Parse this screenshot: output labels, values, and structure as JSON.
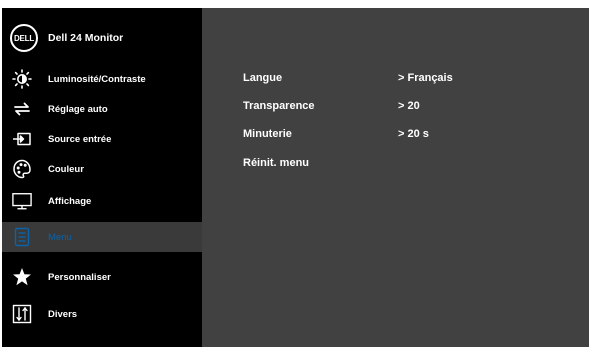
{
  "header": {
    "title": "Dell 24 Monitor",
    "logo_text": "DELL"
  },
  "sidebar": {
    "items": [
      {
        "label": "Luminosité/Contraste",
        "icon": "brightness-icon"
      },
      {
        "label": "Réglage auto",
        "icon": "auto-adjust-icon"
      },
      {
        "label": "Source entrée",
        "icon": "input-source-icon"
      },
      {
        "label": "Couleur",
        "icon": "color-palette-icon"
      },
      {
        "label": "Affichage",
        "icon": "display-icon"
      },
      {
        "label": "Menu",
        "icon": "menu-icon",
        "selected": true
      },
      {
        "label": "Personnaliser",
        "icon": "star-icon"
      },
      {
        "label": "Divers",
        "icon": "others-icon"
      }
    ]
  },
  "settings": [
    {
      "name": "Langue",
      "value": "> Français"
    },
    {
      "name": "Transparence",
      "value": "> 20"
    },
    {
      "name": "Minuterie",
      "value": "> 20 s"
    },
    {
      "name": "Réinit. menu",
      "value": ""
    }
  ],
  "colors": {
    "accent": "#0b63a8",
    "panel": "#414141",
    "sidebar": "#000000"
  }
}
